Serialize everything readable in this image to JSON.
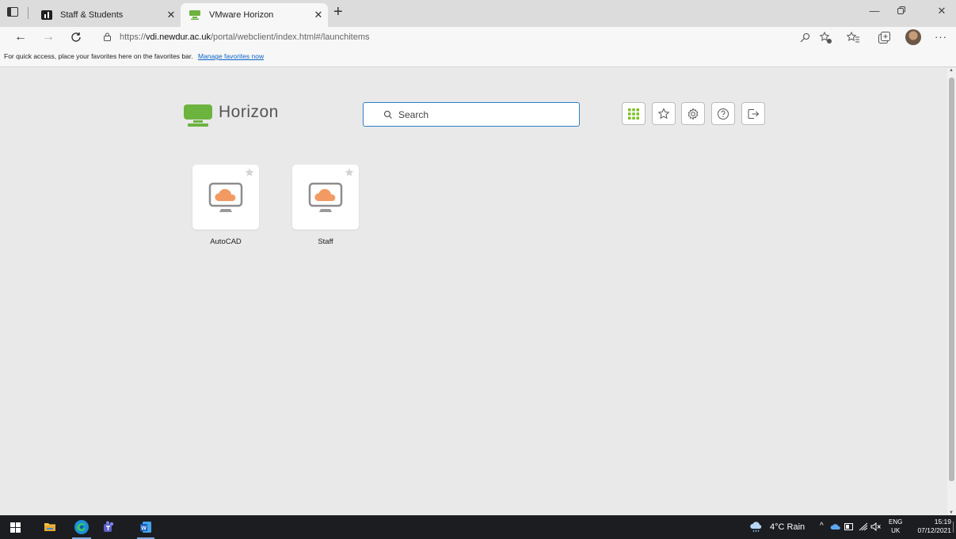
{
  "browser": {
    "tabs": [
      {
        "title": "Staff & Students",
        "active": false
      },
      {
        "title": "VMware Horizon",
        "active": true
      }
    ],
    "new_tab_label": "+",
    "url_prefix": "https://",
    "url_host": "vdi.newdur.ac.uk",
    "url_path": "/portal/webclient/index.html#/launchitems",
    "favorites_bar_text": "For quick access, place your favorites here on the favorites bar.",
    "favorites_bar_link": "Manage favorites now"
  },
  "horizon": {
    "brand": "Horizon",
    "search_placeholder": "Search",
    "brand_color": "#6db33f",
    "apps": [
      {
        "label": "AutoCAD"
      },
      {
        "label": "Staff"
      }
    ]
  },
  "taskbar": {
    "weather": "4°C Rain",
    "lang_top": "ENG",
    "lang_bottom": "UK",
    "time": "15:19",
    "date": "07/12/2021"
  }
}
